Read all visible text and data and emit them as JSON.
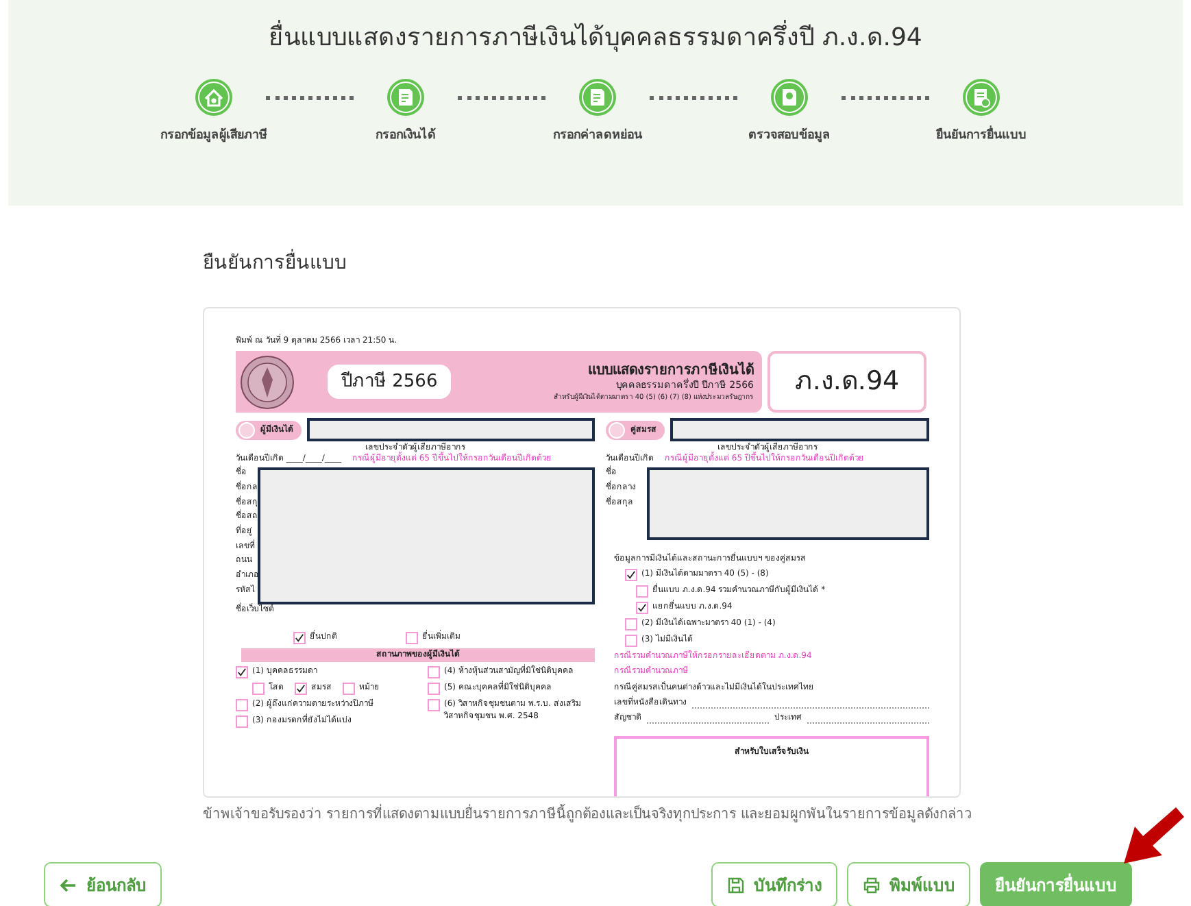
{
  "header": {
    "title": "ยื่นแบบแสดงรายการภาษีเงินได้บุคคลธรรมดาครึ่งปี ภ.ง.ด.94",
    "steps": [
      {
        "label": "กรอกข้อมูลผู้เสียภาษี"
      },
      {
        "label": "กรอกเงินได้"
      },
      {
        "label": "กรอกค่าลดหย่อน"
      },
      {
        "label": "ตรวจสอบข้อมูล"
      },
      {
        "label": "ยืนยันการยื่นแบบ"
      }
    ]
  },
  "section_title": "ยืนยันการยื่นแบบ",
  "document": {
    "printed_at": "พิมพ์ ณ วันที่ 9 ตุลาคม 2566 เวลา 21:50 น.",
    "tax_year": "ปีภาษี 2566",
    "form_title": "แบบแสดงรายการภาษีเงินได้",
    "form_subtitle": "บุคคลธรรมดาครึ่งปี ปีภาษี 2566",
    "form_note": "สำหรับผู้มีเงินได้ตามมาตรา 40 (5) (6) (7) (8) แห่งประมวลรัษฎากร",
    "form_code": "ภ.ง.ด.94",
    "taxpayer": {
      "tag": "ผู้มีเงินได้",
      "id_label": "เลขประจำตัวผู้เสียภาษีอากร",
      "birth_label": "วันเดือนปีเกิด ____/____/____",
      "birth_note": "กรณีผู้มีอายุตั้งแต่ 65 ปีขึ้นไปให้กรอกวันเดือนปีเกิดด้วย",
      "labels": [
        "ชื่อ",
        "ชื่อกล",
        "ชื่อสกุ",
        "ชื่อสถ",
        "ที่อยู่",
        "เลขที่",
        "ถนน",
        "อำเภอ",
        "รหัสไ"
      ],
      "website_label": "ชื่อเว็บไซต์"
    },
    "filing": [
      {
        "label": "ยื่นปกติ",
        "checked": true
      },
      {
        "label": "ยื่นเพิ่มเติม",
        "checked": false
      }
    ],
    "status_title": "สถานภาพของผู้มีเงินได้",
    "status_left": [
      {
        "label": "(1) บุคคลธรรมดา",
        "checked": true,
        "children": [
          {
            "label": "โสด",
            "checked": false
          },
          {
            "label": "สมรส",
            "checked": true
          },
          {
            "label": "หม้าย",
            "checked": false
          }
        ]
      },
      {
        "label": "(2) ผู้ถึงแก่ความตายระหว่างปีภาษี",
        "checked": false
      },
      {
        "label": "(3) กองมรดกที่ยังไม่ได้แบ่ง",
        "checked": false
      }
    ],
    "status_right": [
      {
        "label": "(4) ห้างหุ้นส่วนสามัญที่มิใช่นิติบุคคล",
        "checked": false
      },
      {
        "label": "(5) คณะบุคคลที่มิใช่นิติบุคคล",
        "checked": false
      },
      {
        "label": "(6) วิสาหกิจชุมชนตาม พ.ร.บ. ส่งเสริมวิสาหกิจชุมชน พ.ศ. 2548",
        "checked": false
      }
    ],
    "spouse": {
      "tag": "คู่สมรส",
      "id_label": "เลขประจำตัวผู้เสียภาษีอากร",
      "birth_label": "วันเดือนปีเกิด",
      "birth_note": "กรณีผู้มีอายุตั้งแต่ 65 ปีขึ้นไปให้กรอกวันเดือนปีเกิดด้วย",
      "labels": [
        "ชื่อ",
        "ชื่อกลาง",
        "ชื่อสกุล"
      ]
    },
    "spouse_income": {
      "title": "ข้อมูลการมีเงินได้และสถานะการยื่นแบบฯ ของคู่สมรส",
      "options": [
        {
          "label": "(1) มีเงินได้ตามมาตรา 40 (5) - (8)",
          "checked": true,
          "children": [
            {
              "label": "ยื่นแบบ ภ.ง.ด.94 รวมคำนวณภาษีกับผู้มีเงินได้ *",
              "checked": false
            },
            {
              "label": "แยกยื่นแบบ ภ.ง.ด.94",
              "checked": true
            }
          ]
        },
        {
          "label": "(2) มีเงินได้เฉพาะมาตรา 40 (1) - (4)",
          "checked": false
        },
        {
          "label": "(3) ไม่มีเงินได้",
          "checked": false
        }
      ],
      "notes": [
        "กรณีรวมคำนวณภาษีให้กรอกรายละเอียดตาม ภ.ง.ด.94",
        "กรณีรวมคำนวณภาษี"
      ],
      "foreign_note": "กรณีคู่สมรสเป็นคนต่างด้าวและไม่มีเงินได้ในประเทศไทย",
      "passport_label": "เลขที่หนังสือเดินทาง",
      "nationality_label": "สัญชาติ",
      "country_label": "ประเทศ",
      "receipt_title": "สำหรับใบเสร็จรับเงิน"
    }
  },
  "declaration": "ข้าพเจ้าขอรับรองว่า รายการที่แสดงตามแบบยื่นรายการภาษีนี้ถูกต้องและเป็นจริงทุกประการ และยอมผูกพันในรายการข้อมูลดังกล่าว",
  "buttons": [
    {
      "label": "ย้อนกลับ",
      "kind": "back"
    },
    {
      "label": "บันทึกร่าง",
      "kind": "save"
    },
    {
      "label": "พิมพ์แบบ",
      "kind": "print"
    },
    {
      "label": "ยืนยันการยื่นแบบ",
      "kind": "confirm"
    }
  ]
}
